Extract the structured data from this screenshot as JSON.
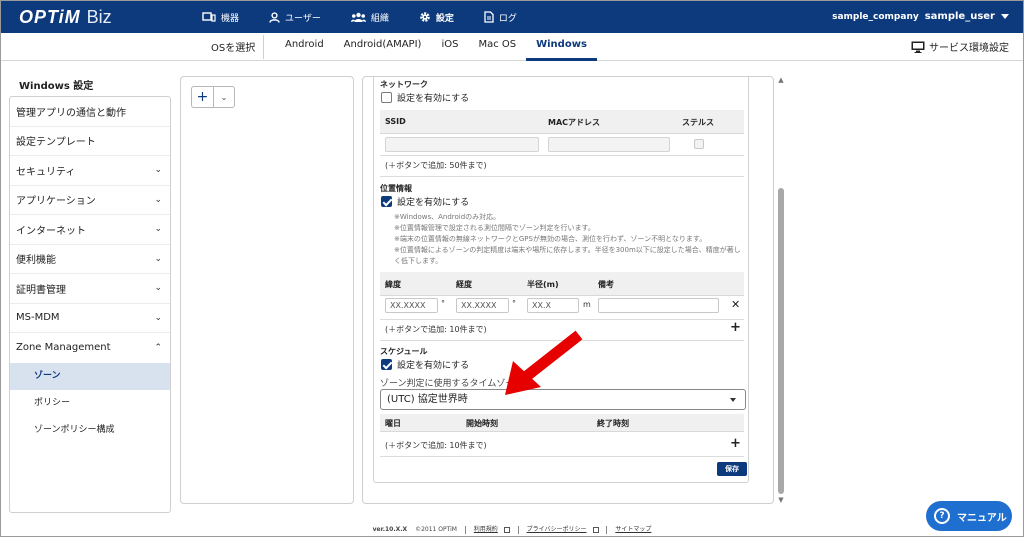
{
  "brand": {
    "name": "OPTiM",
    "product": "Biz"
  },
  "topnav": [
    {
      "label": "機器",
      "icon": "device-icon"
    },
    {
      "label": "ユーザー",
      "icon": "user-icon"
    },
    {
      "label": "組織",
      "icon": "group-icon"
    },
    {
      "label": "設定",
      "icon": "gear-icon",
      "active": true
    },
    {
      "label": "ログ",
      "icon": "log-icon"
    }
  ],
  "user": {
    "company": "sample_company",
    "name": "sample_user"
  },
  "subnav": {
    "os_select_label": "OSを選択",
    "tabs": [
      "Android",
      "Android(AMAPI)",
      "iOS",
      "Mac OS",
      "Windows"
    ],
    "active_tab": "Windows",
    "service_settings_label": "サービス環境設定"
  },
  "sidebar": {
    "title": "Windows 設定",
    "items": [
      {
        "label": "管理アプリの通信と動作",
        "expandable": false
      },
      {
        "label": "設定テンプレート",
        "expandable": false
      },
      {
        "label": "セキュリティ",
        "expandable": true
      },
      {
        "label": "アプリケーション",
        "expandable": true
      },
      {
        "label": "インターネット",
        "expandable": true
      },
      {
        "label": "便利機能",
        "expandable": true
      },
      {
        "label": "証明書管理",
        "expandable": true
      },
      {
        "label": "MS-MDM",
        "expandable": true
      },
      {
        "label": "Zone Management",
        "expandable": true,
        "expanded": true
      }
    ],
    "subitems": [
      {
        "label": "ゾーン",
        "active": true
      },
      {
        "label": "ポリシー"
      },
      {
        "label": "ゾーンポリシー構成"
      }
    ]
  },
  "network": {
    "title": "ネットワーク",
    "enable_label": "設定を有効にする",
    "enabled": false,
    "columns": [
      "SSID",
      "MACアドレス",
      "ステルス"
    ],
    "hint": "(＋ボタンで追加: 50件まで)"
  },
  "location": {
    "title": "位置情報",
    "enable_label": "設定を有効にする",
    "enabled": true,
    "notes": [
      "※Windows、Androidのみ対応。",
      "※位置情報管理で設定される測位間隔でゾーン判定を行います。",
      "※端末の位置情報の無線ネットワークとGPSが無効の場合、測位を行わず、ゾーン不明となります。",
      "※位置情報によるゾーンの判定精度は端末や場所に依存します。半径を300m以下に設定した場合、精度が著しく低下します。"
    ],
    "columns": [
      "緯度",
      "経度",
      "半径(m)",
      "備考"
    ],
    "row": {
      "lat": "XX.XXXX",
      "lng": "XX.XXXX",
      "radius": "XX.X",
      "note": ""
    },
    "deg": "°",
    "unit_m": "m",
    "hint": "(＋ボタンで追加: 10件まで)"
  },
  "schedule": {
    "title": "スケジュール",
    "enable_label": "設定を有効にする",
    "enabled": true,
    "tz_label": "ゾーン判定に使用するタイムゾーン:",
    "tz_value": "(UTC) 協定世界時",
    "columns": [
      "曜日",
      "開始時刻",
      "終了時刻"
    ],
    "hint": "(＋ボタンで追加: 10件まで)"
  },
  "save_label": "保存",
  "footer": {
    "version": "ver.10.X.X",
    "copyright": "©2011 OPTiM",
    "links": [
      "利用規約",
      "プライバシーポリシー",
      "サイトマップ"
    ]
  },
  "manual_label": "マニュアル",
  "colors": {
    "primary": "#0d3a7d",
    "manual": "#1f6fd0",
    "arrow": "#e60000"
  }
}
